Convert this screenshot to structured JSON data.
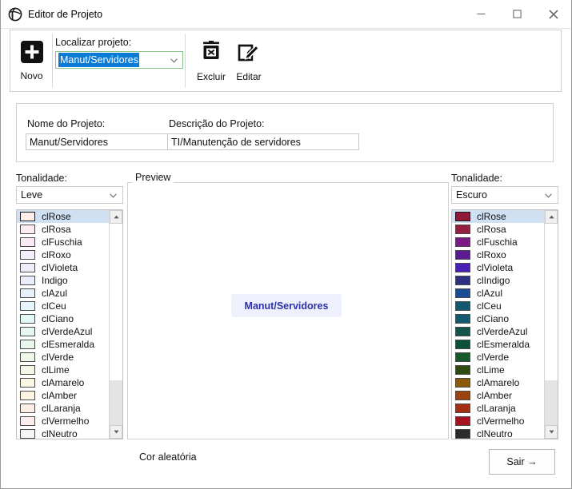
{
  "window": {
    "title": "Editor de Projeto",
    "icon": "app-globe-icon",
    "controls": {
      "minimize": "minimize-icon",
      "maximize": "maximize-icon",
      "close": "close-icon"
    }
  },
  "toolbar": {
    "new_label": "Novo",
    "new_icon": "plus-square-icon",
    "find_label": "Localizar projeto:",
    "find_value": "Manut/Servidores",
    "delete_label": "Excluir",
    "delete_icon": "trash-x-icon",
    "edit_label": "Editar",
    "edit_icon": "pencil-square-icon"
  },
  "project": {
    "name_label": "Nome do Projeto:",
    "name_value": "Manut/Servidores",
    "desc_label": "Descrição do Projeto:",
    "desc_value": "TI/Manutenção de servidores"
  },
  "left_panel": {
    "tone_label": "Tonalidade:",
    "tone_value": "Leve",
    "selected_index": 0,
    "items": [
      {
        "label": "clRose",
        "color": "#fdeeeb"
      },
      {
        "label": "clRosa",
        "color": "#fcecf1"
      },
      {
        "label": "clFuschia",
        "color": "#fbeaf6"
      },
      {
        "label": "clRoxo",
        "color": "#f4edfa"
      },
      {
        "label": "clVioleta",
        "color": "#eeeefb"
      },
      {
        "label": "Indigo",
        "color": "#e9ecfa"
      },
      {
        "label": "clAzul",
        "color": "#e8f1fb"
      },
      {
        "label": "clCeu",
        "color": "#e6f5fb"
      },
      {
        "label": "clCiano",
        "color": "#e4f7f7"
      },
      {
        "label": "clVerdeAzul",
        "color": "#e6f6f0"
      },
      {
        "label": "clEsmeralda",
        "color": "#e8f6ec"
      },
      {
        "label": "clVerde",
        "color": "#edf7ea"
      },
      {
        "label": "clLime",
        "color": "#f3f8e6"
      },
      {
        "label": "clAmarelo",
        "color": "#fdf8e3"
      },
      {
        "label": "clAmber",
        "color": "#fdf4e3"
      },
      {
        "label": "clLaranja",
        "color": "#fdefe6"
      },
      {
        "label": "clVermelho",
        "color": "#fdecec"
      },
      {
        "label": "clNeutro",
        "color": "#f6f5f3"
      }
    ]
  },
  "right_panel": {
    "tone_label": "Tonalidade:",
    "tone_value": "Escuro",
    "selected_index": 0,
    "items": [
      {
        "label": "clRose",
        "color": "#8e1938"
      },
      {
        "label": "clRosa",
        "color": "#94203f"
      },
      {
        "label": "clFuschia",
        "color": "#7b1b85"
      },
      {
        "label": "clRoxo",
        "color": "#5b1b90"
      },
      {
        "label": "clVioleta",
        "color": "#4a21b5"
      },
      {
        "label": "clIndigo",
        "color": "#2e3181"
      },
      {
        "label": "clAzul",
        "color": "#1b4b93"
      },
      {
        "label": "clCeu",
        "color": "#13576f"
      },
      {
        "label": "clCiano",
        "color": "#145a6e"
      },
      {
        "label": "clVerdeAzul",
        "color": "#14544b"
      },
      {
        "label": "clEsmeralda",
        "color": "#0d503a"
      },
      {
        "label": "clVerde",
        "color": "#18592c"
      },
      {
        "label": "clLime",
        "color": "#2e4a11"
      },
      {
        "label": "clAmarelo",
        "color": "#8a5a0c"
      },
      {
        "label": "clAmber",
        "color": "#974410"
      },
      {
        "label": "clLaranja",
        "color": "#a02f14"
      },
      {
        "label": "clVermelho",
        "color": "#a51220"
      },
      {
        "label": "clNeutro",
        "color": "#2b2b2b"
      }
    ]
  },
  "preview": {
    "legend": "Preview",
    "button_label": "Manut/Servidores",
    "button_bg": "#eef1fd",
    "button_fg": "#2b31a8"
  },
  "footer": {
    "random_color_label": "Cor aleatória",
    "exit_label": "Sair →"
  }
}
